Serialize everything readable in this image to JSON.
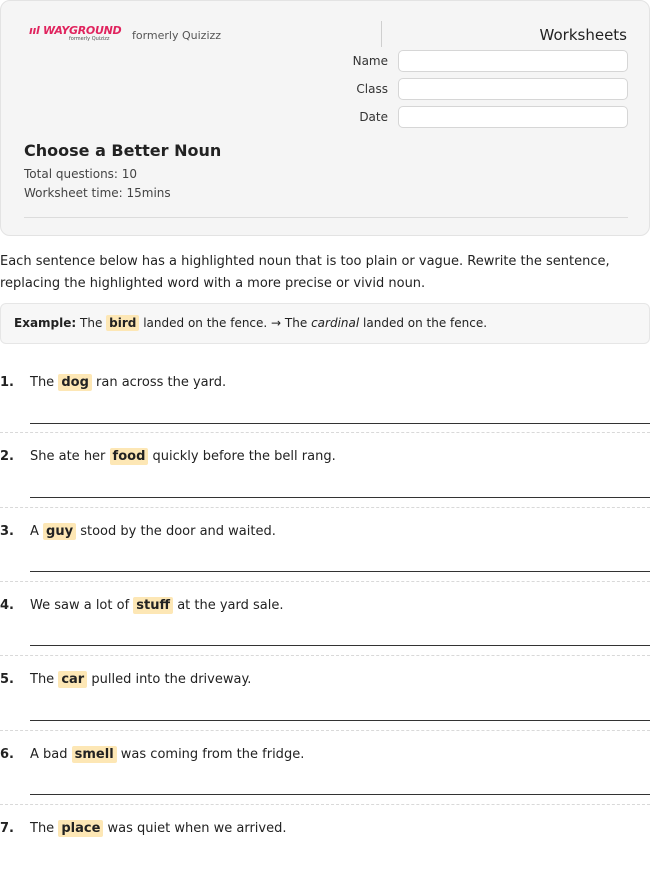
{
  "header": {
    "logo_text": "WAYGROUND",
    "logo_sub": "formerly Quizizz",
    "formerly": "formerly Quizizz",
    "worksheets_label": "Worksheets",
    "fields": {
      "name": "Name",
      "class": "Class",
      "date": "Date"
    },
    "title": "Choose a Better Noun",
    "total_questions": "Total questions: 10",
    "worksheet_time": "Worksheet time: 15mins"
  },
  "intro": "Each sentence below has a highlighted noun that is too plain or vague. Rewrite the sentence, replacing the highlighted word with a more precise or vivid noun.",
  "example": {
    "label": "Example:",
    "before": "The",
    "noun": "bird",
    "after": "landed on the fence. → The",
    "replacement": "cardinal",
    "end": "landed on the fence."
  },
  "questions": [
    {
      "num": "1.",
      "before": "The",
      "noun": "dog",
      "after": "ran across the yard."
    },
    {
      "num": "2.",
      "before": "She ate her",
      "noun": "food",
      "after": "quickly before the bell rang."
    },
    {
      "num": "3.",
      "before": "A",
      "noun": "guy",
      "after": "stood by the door and waited."
    },
    {
      "num": "4.",
      "before": "We saw a lot of",
      "noun": "stuff",
      "after": "at the yard sale."
    },
    {
      "num": "5.",
      "before": "The",
      "noun": "car",
      "after": "pulled into the driveway."
    },
    {
      "num": "6.",
      "before": "A bad",
      "noun": "smell",
      "after": "was coming from the fridge."
    },
    {
      "num": "7.",
      "before": "The",
      "noun": "place",
      "after": "was quiet when we arrived."
    }
  ]
}
